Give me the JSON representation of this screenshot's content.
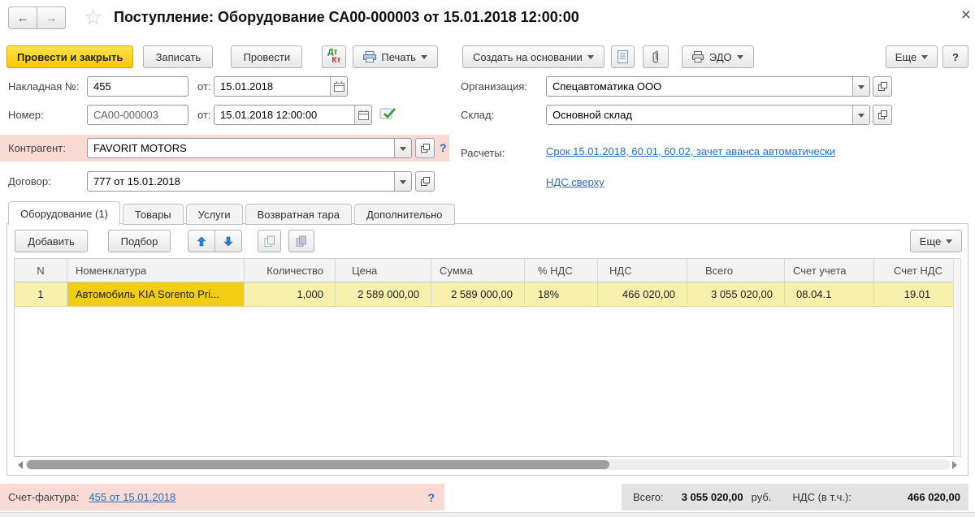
{
  "titlebar": {
    "back": "←",
    "forward": "→",
    "title": "Поступление: Оборудование СА00-000003 от 15.01.2018 12:00:00",
    "close": "×"
  },
  "toolbar": {
    "post_and_close": "Провести и закрыть",
    "save": "Записать",
    "post": "Провести",
    "dt": "Дт",
    "kt": "Кт",
    "print": "Печать",
    "create_based_on": "Создать на основании",
    "edo": "ЭДО",
    "more": "Еще",
    "help": "?"
  },
  "form": {
    "invoice_label": "Накладная  №:",
    "invoice_no": "455",
    "from1_label": "от:",
    "invoice_date": "15.01.2018",
    "number_label": "Номер:",
    "number": "СА00-000003",
    "from2_label": "от:",
    "number_datetime": "15.01.2018 12:00:00",
    "counterparty_label": "Контрагент:",
    "counterparty": "FAVORIT MOTORS",
    "counterparty_help": "?",
    "contract_label": "Договор:",
    "contract": "777 от 15.01.2018",
    "org_label": "Организация:",
    "org": "Спецавтоматика ООО",
    "warehouse_label": "Склад:",
    "warehouse": "Основной склад",
    "settlements_label": "Расчеты:",
    "settlements_link": "Срок 15.01.2018, 60.01, 60.02, зачет аванса автоматически",
    "vat_mode_link": "НДС сверху"
  },
  "tabs": {
    "t0": "Оборудование (1)",
    "t1": "Товары",
    "t2": "Услуги",
    "t3": "Возвратная тара",
    "t4": "Дополнительно"
  },
  "table": {
    "add": "Добавить",
    "pick": "Подбор",
    "more": "Еще",
    "columns": [
      "N",
      "Номенклатура",
      "Количество",
      "Цена",
      "Сумма",
      "% НДС",
      "НДС",
      "Всего",
      "Счет учета",
      "Счет НДС"
    ],
    "row": {
      "n": "1",
      "name": "Автомобиль KIA Sorento Pri...",
      "qty": "1,000",
      "price": "2 589 000,00",
      "sum": "2 589 000,00",
      "vat_pct": "18%",
      "vat": "466 020,00",
      "total": "3 055 020,00",
      "account": "08.04.1",
      "vat_account": "19.01"
    }
  },
  "footer": {
    "invoice_label": "Счет-фактура:",
    "invoice_link": "455 от 15.01.2018",
    "help": "?",
    "total_label": "Всего:",
    "total_value": "3 055 020,00",
    "currency": "руб.",
    "vat_label": "НДС (в т.ч.):",
    "vat_value": "466 020,00"
  },
  "colors": {
    "accent_yellow": "#fcc800",
    "row_yellow": "#f8f1ae",
    "cell_yellow": "#f1ce13",
    "pink_highlight": "#fadad5",
    "link_blue": "#2a6ebd"
  }
}
